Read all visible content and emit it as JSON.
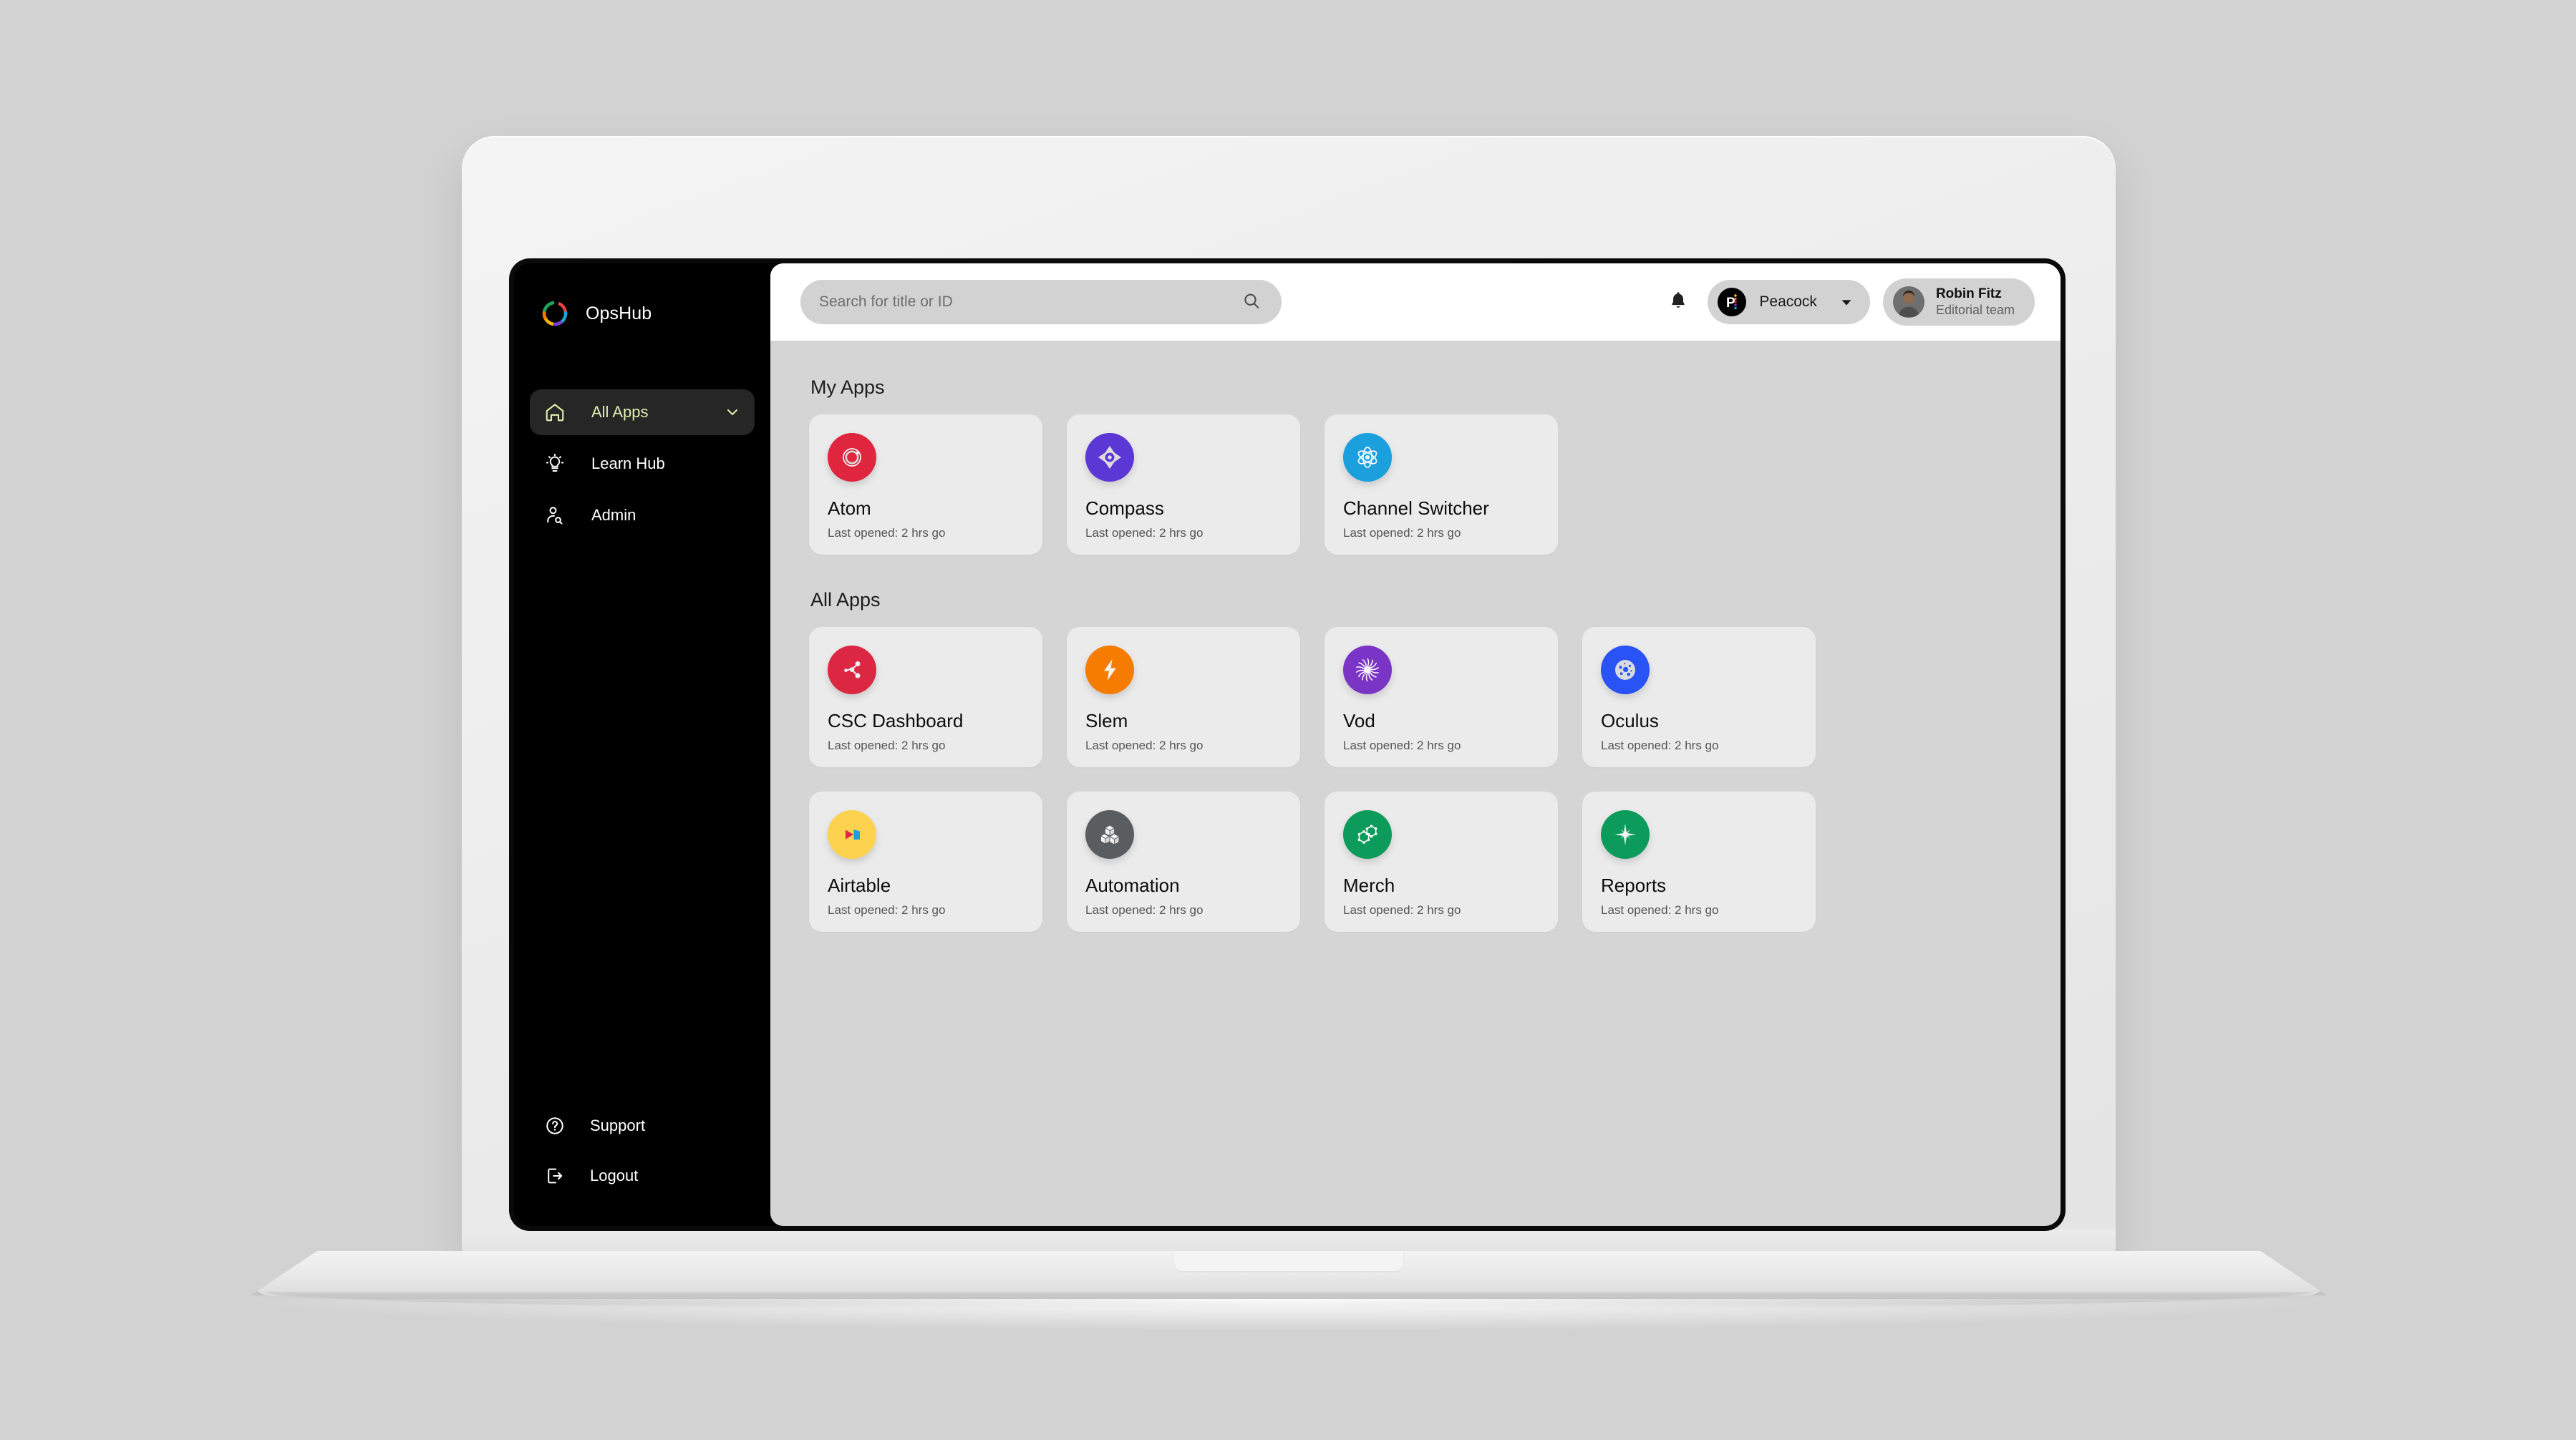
{
  "brand": {
    "name": "OpsHub",
    "logo_icon": "ring-logo-icon"
  },
  "sidebar": {
    "items": [
      {
        "label": "All Apps",
        "icon": "home-icon",
        "active": true,
        "chevron": "chevron-down-icon"
      },
      {
        "label": "Learn Hub",
        "icon": "lightbulb-icon",
        "active": false
      },
      {
        "label": "Admin",
        "icon": "user-search-icon",
        "active": false
      }
    ],
    "bottom_items": [
      {
        "label": "Support",
        "icon": "help-circle-icon"
      },
      {
        "label": "Logout",
        "icon": "logout-icon"
      }
    ],
    "active_color": "#dff0ae",
    "background": "#000000"
  },
  "topbar": {
    "search": {
      "placeholder": "Search for title or ID",
      "value": "",
      "icon": "search-icon"
    },
    "notifications_icon": "bell-icon",
    "tenant": {
      "name": "Peacock",
      "logo_icon": "peacock-logo-icon",
      "caret_icon": "caret-down-icon"
    },
    "user": {
      "name": "Robin Fitz",
      "team": "Editorial team",
      "avatar_icon": "avatar-icon"
    }
  },
  "content": {
    "my_apps_title": "My Apps",
    "all_apps_title": "All Apps",
    "my_apps": [
      {
        "name": "Atom",
        "subtitle": "Last opened: 2 hrs go",
        "icon": "atom-orbit-icon",
        "color": "#e0263f"
      },
      {
        "name": "Compass",
        "subtitle": "Last opened: 2 hrs go",
        "icon": "compass-icon",
        "color": "#5b37d6"
      },
      {
        "name": "Channel Switcher",
        "subtitle": "Last opened: 2 hrs go",
        "icon": "molecule-icon",
        "color": "#1ba0dd"
      }
    ],
    "all_apps": [
      {
        "name": "CSC Dashboard",
        "subtitle": "Last opened: 2 hrs go",
        "icon": "share-nodes-icon",
        "color": "#dc2743"
      },
      {
        "name": "Slem",
        "subtitle": "Last opened: 2 hrs go",
        "icon": "lightning-bolt-icon",
        "color": "#f57c00"
      },
      {
        "name": "Vod",
        "subtitle": "Last opened: 2 hrs go",
        "icon": "starburst-radial-icon",
        "color": "#7b35c6"
      },
      {
        "name": "Oculus",
        "subtitle": "Last opened: 2 hrs go",
        "icon": "crater-disc-icon",
        "color": "#2a53f5"
      },
      {
        "name": "Airtable",
        "subtitle": "Last opened: 2 hrs go",
        "icon": "airtable-shapes-icon",
        "color": "#fcd24f"
      },
      {
        "name": "Automation",
        "subtitle": "Last opened: 2 hrs go",
        "icon": "cube-cluster-icon",
        "color": "#5a5d60"
      },
      {
        "name": "Merch",
        "subtitle": "Last opened: 2 hrs go",
        "icon": "hexagon-molecule-icon",
        "color": "#0d9b5c"
      },
      {
        "name": "Reports",
        "subtitle": "Last opened: 2 hrs go",
        "icon": "sparkle-star-icon",
        "color": "#0d9b5c"
      }
    ]
  }
}
